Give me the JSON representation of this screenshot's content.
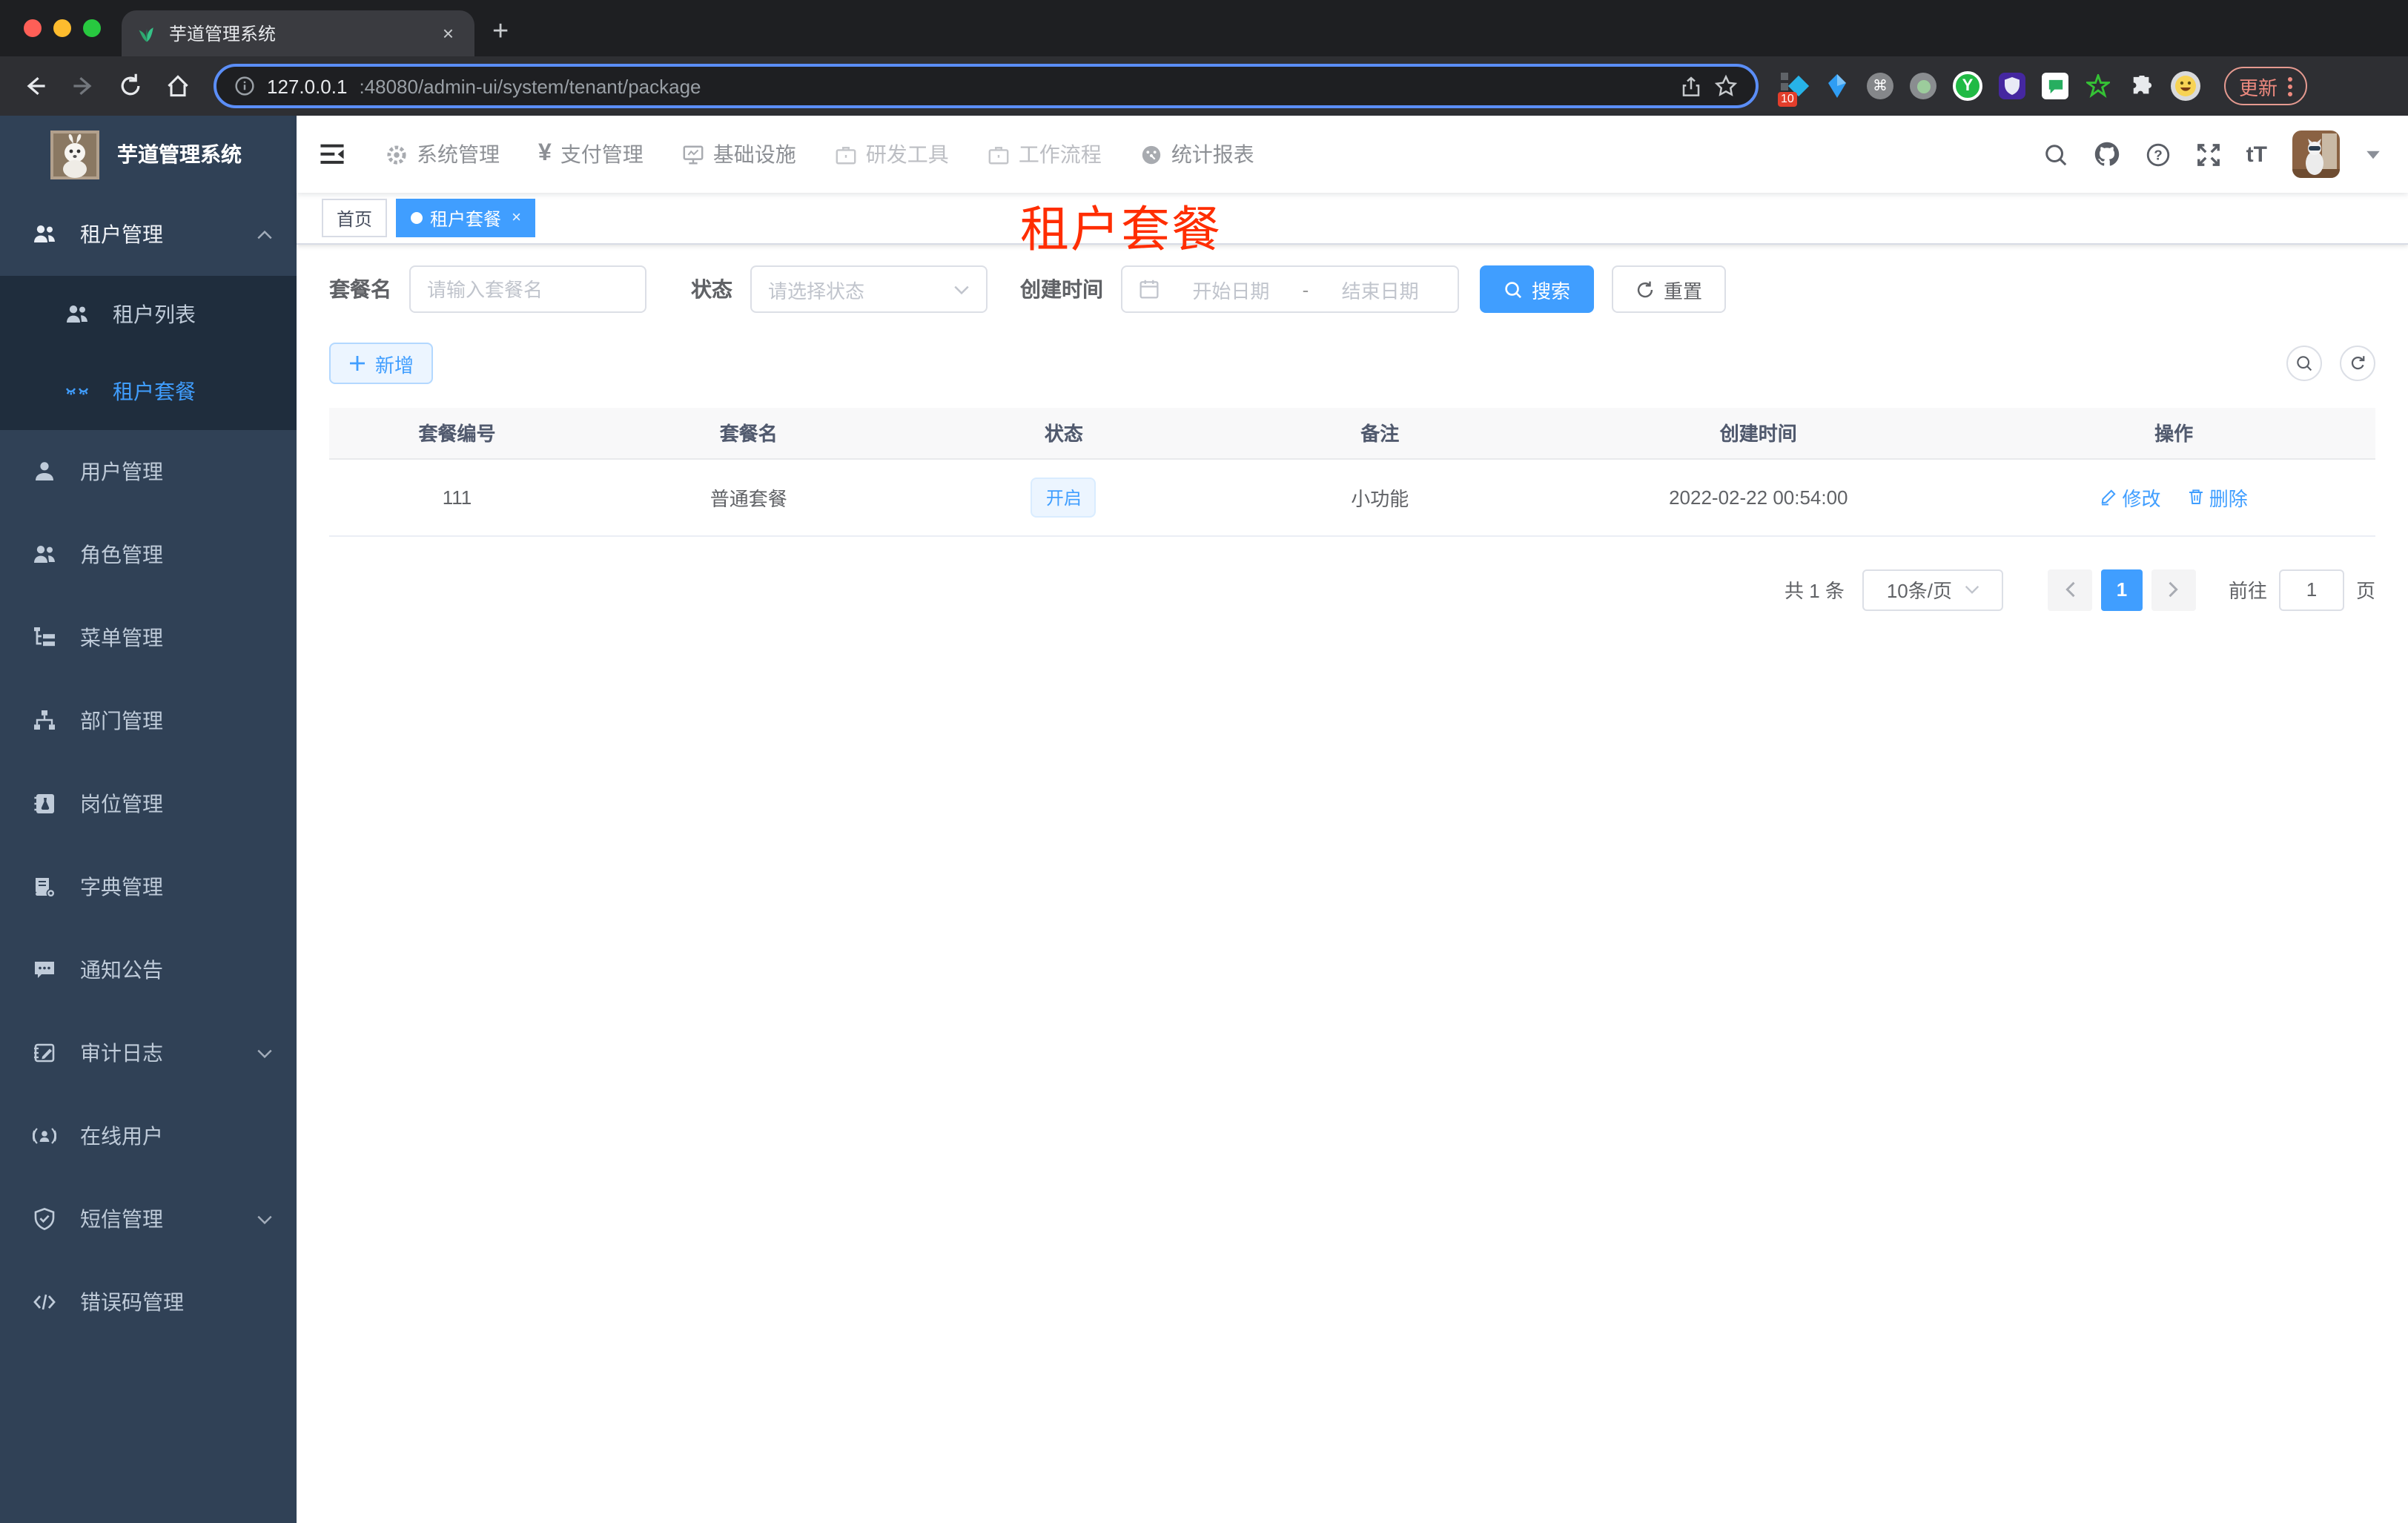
{
  "browser": {
    "tab": {
      "title": "芋道管理系统",
      "favicon": "plant-icon",
      "close": "×",
      "new_tab": "+"
    },
    "url": {
      "host": "127.0.0.1",
      "path": ":48080/admin-ui/system/tenant/package"
    },
    "extensions": {
      "badge": "10",
      "icons": [
        "squares-diamond",
        "gem",
        "command-circle",
        "recorder-circle",
        "yudao-green",
        "purple-shield",
        "green-chat",
        "green-star",
        "puzzle",
        "emoji-face"
      ],
      "yudao_letter": "Y",
      "command_glyph": "⌘"
    },
    "update_button": "更新"
  },
  "header": {
    "menu": [
      {
        "label": "系统管理",
        "icon": "gear"
      },
      {
        "label": "支付管理",
        "icon": "yen"
      },
      {
        "label": "基础设施",
        "icon": "monitor"
      },
      {
        "label": "研发工具",
        "icon": "briefcase"
      },
      {
        "label": "工作流程",
        "icon": "briefcase"
      },
      {
        "label": "统计报表",
        "icon": "dashboard"
      }
    ],
    "yen_glyph": "¥",
    "font_size_icon": "tT"
  },
  "sidebar": {
    "logo_title": "芋道管理系统",
    "items": [
      {
        "label": "租户管理",
        "icon": "peoples"
      },
      {
        "label": "租户列表",
        "icon": "peoples"
      },
      {
        "label": "租户套餐",
        "icon": "lashes"
      },
      {
        "label": "用户管理",
        "icon": "user"
      },
      {
        "label": "角色管理",
        "icon": "peoples"
      },
      {
        "label": "菜单管理",
        "icon": "tree-table"
      },
      {
        "label": "部门管理",
        "icon": "org-tree"
      },
      {
        "label": "岗位管理",
        "icon": "post-badge"
      },
      {
        "label": "字典管理",
        "icon": "dict-book"
      },
      {
        "label": "通知公告",
        "icon": "message-bubble"
      },
      {
        "label": "审计日志",
        "icon": "log-pencil"
      },
      {
        "label": "在线用户",
        "icon": "online-user"
      },
      {
        "label": "短信管理",
        "icon": "shield-check"
      },
      {
        "label": "错误码管理",
        "icon": "code"
      }
    ]
  },
  "tabs": {
    "home": "首页",
    "active": "租户套餐",
    "close": "×"
  },
  "page": {
    "overlay_title": "租户套餐"
  },
  "filters": {
    "name_label": "套餐名",
    "name_placeholder": "请输入套餐名",
    "status_label": "状态",
    "status_placeholder": "请选择状态",
    "date_label": "创建时间",
    "date_start": "开始日期",
    "date_separator": "-",
    "date_end": "结束日期",
    "search": "搜索",
    "reset": "重置"
  },
  "toolbar": {
    "add": "新增"
  },
  "table": {
    "headers": [
      "套餐编号",
      "套餐名",
      "状态",
      "备注",
      "创建时间",
      "操作"
    ],
    "rows": [
      {
        "id": "111",
        "name": "普通套餐",
        "status": "开启",
        "remark": "小功能",
        "created": "2022-02-22 00:54:00",
        "edit": "修改",
        "delete": "删除"
      }
    ]
  },
  "pagination": {
    "total": "共 1 条",
    "size": "10条/页",
    "current": "1",
    "goto_label": "前往",
    "goto_value": "1",
    "page_unit": "页"
  }
}
